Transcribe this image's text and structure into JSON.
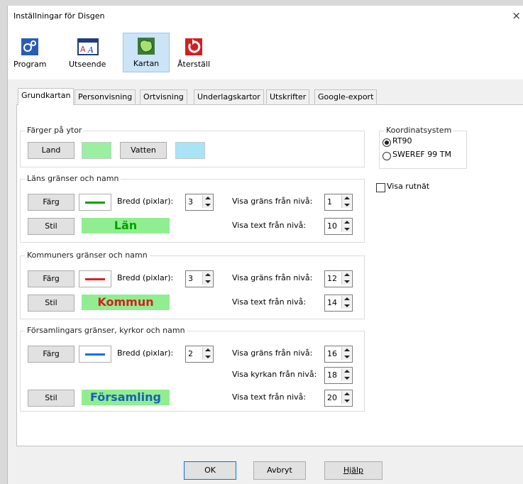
{
  "window": {
    "title": "Inställningar för Disgen",
    "close": "×"
  },
  "toolbar": {
    "items": [
      {
        "label": "Program",
        "icon": "program-gear-icon"
      },
      {
        "label": "Utseende",
        "icon": "appearance-font-icon"
      },
      {
        "label": "Kartan",
        "icon": "map-icon",
        "selected": true
      },
      {
        "label": "Återställ",
        "icon": "reset-icon"
      }
    ]
  },
  "tabs": [
    "Grundkartan",
    "Personvisning",
    "Ortvisning",
    "Underlagskartor",
    "Utskrifter",
    "Google-export"
  ],
  "colors_group": {
    "title": "Färger på ytor",
    "land_label": "Land",
    "land_color": "#99f0a0",
    "water_label": "Vatten",
    "water_color": "#a8e4f6"
  },
  "lan_group": {
    "title": "Läns gränser och namn",
    "color_btn": "Färg",
    "line_color": "#00a000",
    "width_label": "Bredd (pixlar):",
    "width_value": "3",
    "border_level_label": "Visa gräns från nivå:",
    "border_level": "1",
    "style_btn": "Stil",
    "sample_text": "Län",
    "sample_color": "#00a000",
    "text_level_label": "Visa text från nivå:",
    "text_level": "10"
  },
  "kommun_group": {
    "title": "Kommuners gränser och namn",
    "color_btn": "Färg",
    "line_color": "#e02020",
    "width_label": "Bredd (pixlar):",
    "width_value": "3",
    "border_level_label": "Visa gräns från nivå:",
    "border_level": "12",
    "style_btn": "Stil",
    "sample_text": "Kommun",
    "sample_color": "#d42020",
    "text_level_label": "Visa text från nivå:",
    "text_level": "14"
  },
  "forsamling_group": {
    "title": "Församlingars gränser, kyrkor och namn",
    "color_btn": "Färg",
    "line_color": "#1e6ed0",
    "width_label": "Bredd (pixlar):",
    "width_value": "2",
    "border_level_label": "Visa gräns från nivå:",
    "border_level": "16",
    "church_level_label": "Visa kyrkan från nivå:",
    "church_level": "18",
    "style_btn": "Stil",
    "sample_text": "Församling",
    "sample_color": "#1e5cb8",
    "text_level_label": "Visa text från nivå:",
    "text_level": "20"
  },
  "coord_group": {
    "title": "Koordinatsystem",
    "options": [
      "RT90",
      "SWEREF 99 TM"
    ],
    "selected": "RT90"
  },
  "grid_checkbox": {
    "label": "Visa rutnät",
    "checked": false
  },
  "footer": {
    "ok": "OK",
    "cancel": "Avbryt",
    "help": "Hjälp"
  },
  "swatch_bg": "#90ee90"
}
